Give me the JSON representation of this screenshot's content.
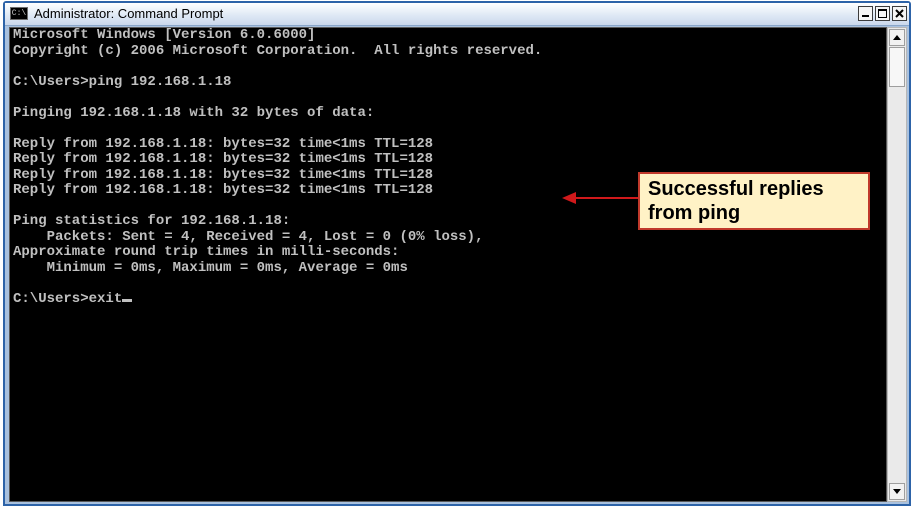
{
  "window": {
    "title": "Administrator: Command Prompt",
    "icon": "cmd-icon",
    "icon_text": "C:\\",
    "controls": [
      "minimize-icon",
      "maximize-icon",
      "close-icon"
    ]
  },
  "console": {
    "text_color": "#c0c0c0",
    "background_color": "#000000",
    "lines": [
      "Microsoft Windows [Version 6.0.6000]",
      "Copyright (c) 2006 Microsoft Corporation.  All rights reserved.",
      "",
      "C:\\Users>ping 192.168.1.18",
      "",
      "Pinging 192.168.1.18 with 32 bytes of data:",
      "",
      "Reply from 192.168.1.18: bytes=32 time<1ms TTL=128",
      "Reply from 192.168.1.18: bytes=32 time<1ms TTL=128",
      "Reply from 192.168.1.18: bytes=32 time<1ms TTL=128",
      "Reply from 192.168.1.18: bytes=32 time<1ms TTL=128",
      "",
      "Ping statistics for 192.168.1.18:",
      "    Packets: Sent = 4, Received = 4, Lost = 0 (0% loss),",
      "Approximate round trip times in milli-seconds:",
      "    Minimum = 0ms, Maximum = 0ms, Average = 0ms",
      "",
      "C:\\Users>exit"
    ]
  },
  "scrollbar": {
    "up_icon": "arrow-up-icon",
    "down_icon": "arrow-down-icon"
  },
  "annotation": {
    "line1": "Successful replies",
    "line2": "from ping",
    "border_color": "#c0392b",
    "background_color": "#fff2c6"
  }
}
